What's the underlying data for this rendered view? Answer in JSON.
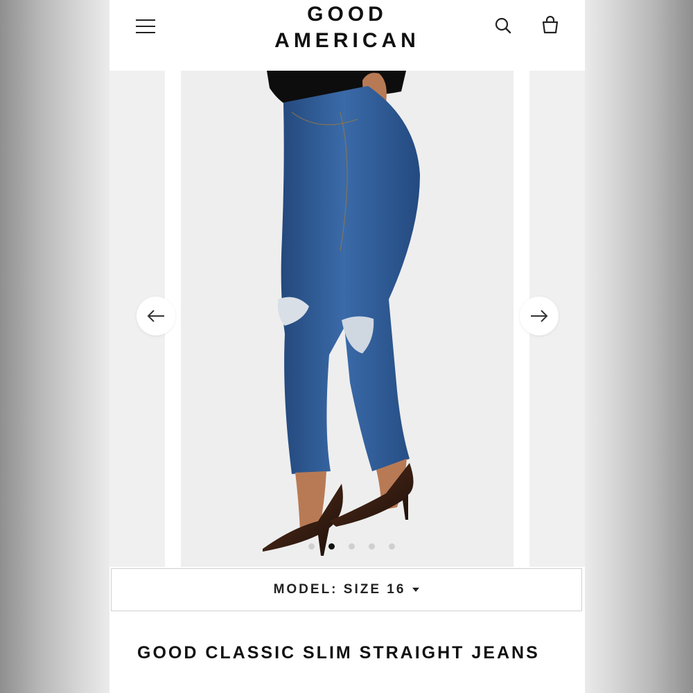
{
  "header": {
    "logo_line1": "GOOD",
    "logo_line2": "AMERICAN",
    "icons": [
      "menu-icon",
      "search-icon",
      "bag-icon"
    ]
  },
  "carousel": {
    "image_description_icon": "product-photo",
    "slide_count": 5,
    "active_index": 1,
    "prev_icon": "arrow-left-icon",
    "next_icon": "arrow-right-icon"
  },
  "model_select": {
    "label": "MODEL: SIZE 16"
  },
  "product": {
    "title": "GOOD CLASSIC SLIM STRAIGHT JEANS"
  },
  "colors": {
    "denim": "#2f5d97",
    "denim_dark": "#1f3f6e",
    "text": "#111111",
    "dot_active": "#111111",
    "dot_inactive": "#cfcfcf"
  }
}
